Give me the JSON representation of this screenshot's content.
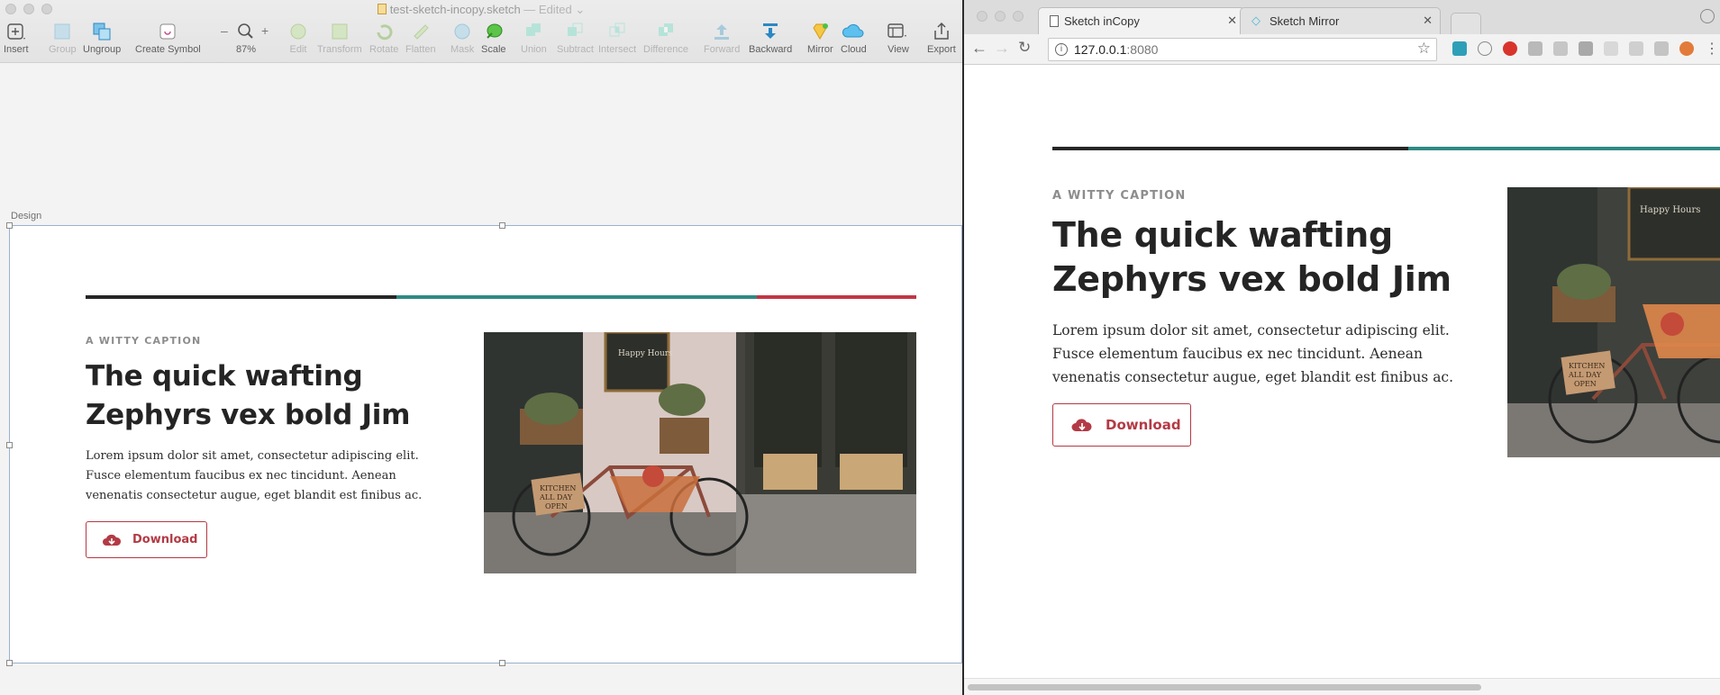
{
  "sketch": {
    "document_name": "test-sketch-incopy.sketch",
    "status": "— Edited",
    "toolbar": [
      {
        "label": "Insert",
        "icon": "insert-icon",
        "enabled": true
      },
      {
        "label": "Group",
        "icon": "group-icon",
        "enabled": false
      },
      {
        "label": "Ungroup",
        "icon": "ungroup-icon",
        "enabled": true
      },
      {
        "label": "Create Symbol",
        "icon": "create-symbol-icon",
        "enabled": true
      },
      {
        "label": "87%",
        "icon": "zoom-icon",
        "enabled": true
      },
      {
        "label": "Edit",
        "icon": "edit-icon",
        "enabled": false
      },
      {
        "label": "Transform",
        "icon": "transform-icon",
        "enabled": false
      },
      {
        "label": "Rotate",
        "icon": "rotate-icon",
        "enabled": false
      },
      {
        "label": "Flatten",
        "icon": "flatten-icon",
        "enabled": false
      },
      {
        "label": "Mask",
        "icon": "mask-icon",
        "enabled": false
      },
      {
        "label": "Scale",
        "icon": "scale-icon",
        "enabled": true
      },
      {
        "label": "Union",
        "icon": "union-icon",
        "enabled": false
      },
      {
        "label": "Subtract",
        "icon": "subtract-icon",
        "enabled": false
      },
      {
        "label": "Intersect",
        "icon": "intersect-icon",
        "enabled": false
      },
      {
        "label": "Difference",
        "icon": "difference-icon",
        "enabled": false
      },
      {
        "label": "Forward",
        "icon": "forward-icon",
        "enabled": false
      },
      {
        "label": "Backward",
        "icon": "backward-icon",
        "enabled": true
      },
      {
        "label": "Mirror",
        "icon": "mirror-icon",
        "enabled": true
      },
      {
        "label": "Cloud",
        "icon": "cloud-icon",
        "enabled": true
      },
      {
        "label": "View",
        "icon": "view-icon",
        "enabled": true
      },
      {
        "label": "Export",
        "icon": "export-icon",
        "enabled": true
      }
    ],
    "artboard_name": "Design"
  },
  "design": {
    "caption": "A WITTY CAPTION",
    "title_line1": "The quick wafting",
    "title_line2": "Zephyrs vex bold Jim",
    "body_line1": "Lorem ipsum dolor sit amet, consectetur adipiscing elit.",
    "body_line2": "Fusce elementum faucibus ex nec tincidunt. Aenean",
    "body_line3": "venenatis consectetur augue, eget blandit est finibus ac.",
    "button_label": "Download",
    "photo_sign_1": "Happy Hours",
    "photo_sign_2": "KITCHEN",
    "photo_sign_3": "ALL DAY",
    "photo_sign_4": "OPEN",
    "colors": {
      "bar_dark": "#262626",
      "bar_teal": "#2e8a83",
      "bar_red": "#c23645",
      "accent": "#b33a45"
    }
  },
  "browser": {
    "tabs": [
      {
        "label": "Sketch inCopy",
        "icon": "page-icon",
        "active": true
      },
      {
        "label": "Sketch Mirror",
        "icon": "diamond-icon",
        "active": false
      }
    ],
    "url_host": "127.0.0.1",
    "url_port": ":8080"
  }
}
